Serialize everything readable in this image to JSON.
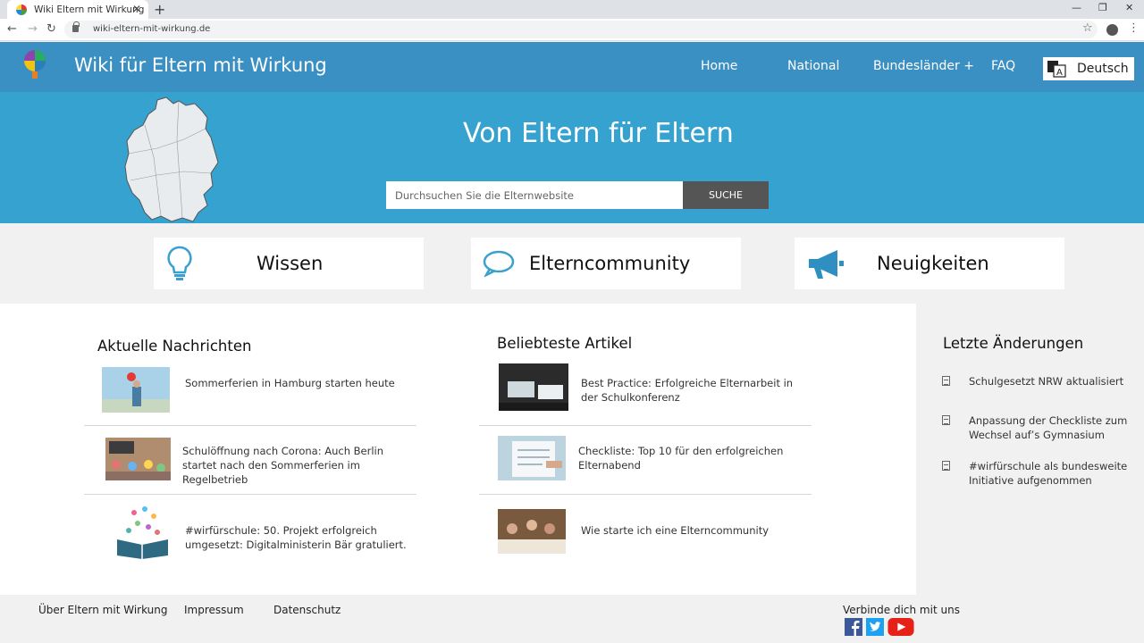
{
  "browser": {
    "tab_title": "Wiki Eltern mit Wirkung",
    "tab_close": "✕",
    "new_tab": "+",
    "url": "wiki-eltern-mit-wirkung.de",
    "window_controls": [
      "—",
      "❐",
      "✕"
    ],
    "nav": {
      "back": "←",
      "forward": "→",
      "reload": "↻"
    },
    "star": "☆",
    "menu": "⋮"
  },
  "header": {
    "title": "Wiki für Eltern mit Wirkung",
    "nav": [
      "Home",
      "National",
      "Bundesländer +",
      "FAQ"
    ],
    "language": "Deutsch",
    "bg_color": "#3a8fc3"
  },
  "hero": {
    "title": "Von Eltern für Eltern",
    "search_placeholder": "Durchsuchen Sie die Elternwebsite",
    "search_button": "SUCHE",
    "bg_color": "#36a2d0"
  },
  "categories": [
    {
      "label": "Wissen",
      "icon": "lightbulb-icon"
    },
    {
      "label": "Elterncommunity",
      "icon": "speech-bubble-icon"
    },
    {
      "label": "Neuigkeiten",
      "icon": "megaphone-icon"
    }
  ],
  "news": {
    "title": "Aktuelle Nachrichten",
    "items": [
      {
        "text": "Sommerferien  in Hamburg starten heute"
      },
      {
        "text": "Schulöffnung nach Corona: Auch Berlin startet nach den Sommerferien  im Regelbetrieb"
      },
      {
        "text": "#wirfürschule: 50. Projekt erfolgreich umgesetzt:  Digitalministerin Bär gratuliert."
      }
    ]
  },
  "popular": {
    "title": "Beliebteste Artikel",
    "items": [
      {
        "text": "Best Practice: Erfolgreiche Elternarbeit in der Schulkonferenz"
      },
      {
        "text": "Checkliste: Top 10 für den erfolgreichen Elternabend"
      },
      {
        "text": "Wie starte ich eine Elterncommunity"
      }
    ]
  },
  "changes": {
    "title": "Letzte Änderungen",
    "items": [
      {
        "text": "Schulgesetzt NRW aktualisiert"
      },
      {
        "text": "Anpassung der Checkliste zum Wechsel auf’s Gymnasium"
      },
      {
        "text": "#wirfürschule  als bundesweite Initiative aufgenommen"
      }
    ]
  },
  "footer": {
    "links": [
      "Über Eltern mit Wirkung",
      "Impressum",
      "Datenschutz"
    ],
    "social_title": "Verbinde dich mit uns",
    "social": [
      "facebook-icon",
      "twitter-icon",
      "youtube-icon"
    ]
  }
}
